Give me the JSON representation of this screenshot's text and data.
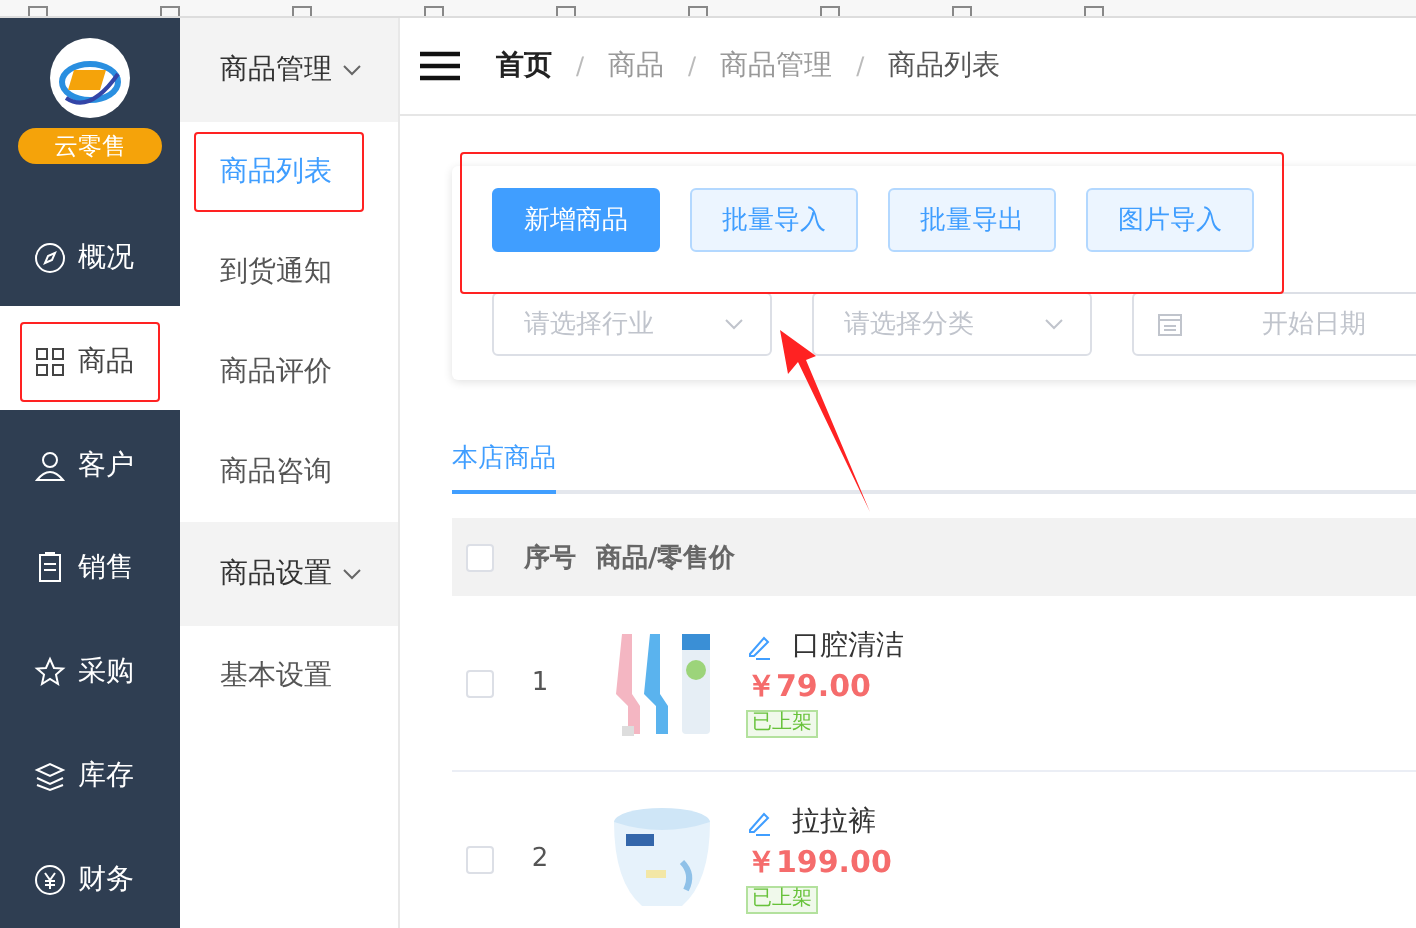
{
  "brand": {
    "badge": "云零售"
  },
  "nav": [
    {
      "label": "概况",
      "selected": false,
      "highlighted": false
    },
    {
      "label": "商品",
      "selected": true,
      "highlighted": true
    },
    {
      "label": "客户",
      "selected": false,
      "highlighted": false
    },
    {
      "label": "销售",
      "selected": false,
      "highlighted": false
    },
    {
      "label": "采购",
      "selected": false,
      "highlighted": false
    },
    {
      "label": "库存",
      "selected": false,
      "highlighted": false
    },
    {
      "label": "财务",
      "selected": false,
      "highlighted": false
    }
  ],
  "submenu": [
    {
      "label": "商品管理",
      "expanded": true,
      "children": [
        {
          "label": "商品列表",
          "selected": true,
          "highlighted": true
        },
        {
          "label": "到货通知",
          "selected": false,
          "highlighted": false
        },
        {
          "label": "商品评价",
          "selected": false,
          "highlighted": false
        },
        {
          "label": "商品咨询",
          "selected": false,
          "highlighted": false
        }
      ]
    },
    {
      "label": "商品设置",
      "expanded": true,
      "children": [
        {
          "label": "基本设置",
          "selected": false,
          "highlighted": false
        }
      ]
    }
  ],
  "breadcrumb": [
    "首页",
    "商品",
    "商品管理",
    "商品列表"
  ],
  "breadcrumb_separator": "/",
  "toolbar": {
    "highlighted": true,
    "buttons": [
      {
        "label": "新增商品",
        "primary": true
      },
      {
        "label": "批量导入",
        "primary": false
      },
      {
        "label": "批量导出",
        "primary": false
      },
      {
        "label": "图片导入",
        "primary": false
      }
    ]
  },
  "filters": [
    {
      "kind": "select",
      "placeholder": "请选择行业"
    },
    {
      "kind": "select",
      "placeholder": "请选择分类"
    },
    {
      "kind": "date",
      "placeholder": "开始日期"
    }
  ],
  "tabs": [
    {
      "label": "本店商品",
      "selected": true
    }
  ],
  "table": {
    "all_checked": false,
    "columns": [
      "序号",
      "商品/零售价"
    ],
    "rows": [
      {
        "index": "1",
        "name": "口腔清洁",
        "price": "￥79.00",
        "status": "已上架",
        "checked": false
      },
      {
        "index": "2",
        "name": "拉拉裤",
        "price": "￥199.00",
        "status": "已上架",
        "checked": false
      }
    ]
  }
}
